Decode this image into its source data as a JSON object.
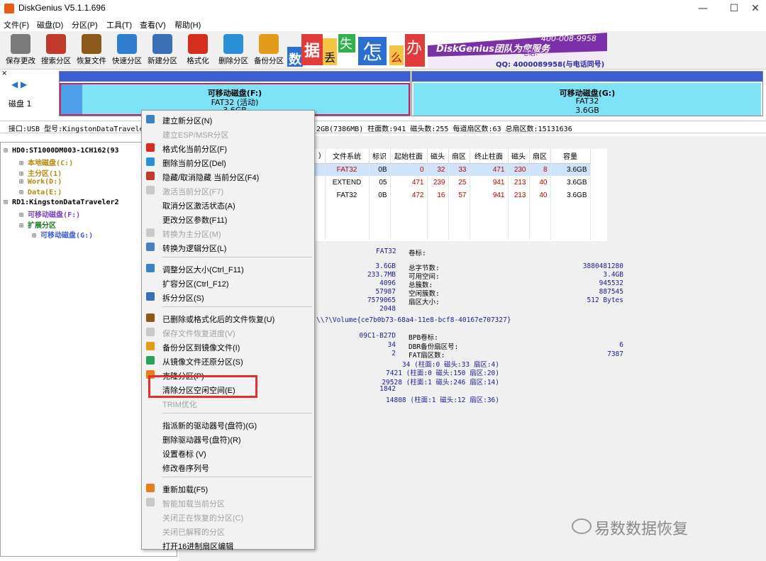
{
  "window": {
    "title": "DiskGenius V5.1.1.696",
    "min": "—",
    "max": "☐",
    "close": "✕"
  },
  "menubar": [
    "文件(F)",
    "磁盘(D)",
    "分区(P)",
    "工具(T)",
    "查看(V)",
    "帮助(H)"
  ],
  "toolbar": [
    {
      "label": "保存更改",
      "icon": "save-icon",
      "color": "#7a7a7a"
    },
    {
      "label": "搜索分区",
      "icon": "magnifier-icon",
      "color": "#c0392b"
    },
    {
      "label": "恢复文件",
      "icon": "recover-box-icon",
      "color": "#8e5a1c"
    },
    {
      "label": "快速分区",
      "icon": "disk-clock-icon",
      "color": "#2e7dd1"
    },
    {
      "label": "新建分区",
      "icon": "new-partition-icon",
      "color": "#3b6fb5"
    },
    {
      "label": "格式化",
      "icon": "format-icon",
      "color": "#d62d20"
    },
    {
      "label": "删除分区",
      "icon": "trash-icon",
      "color": "#2b8fd8"
    },
    {
      "label": "备份分区",
      "icon": "backup-icon",
      "color": "#e39b1b"
    }
  ],
  "banner": {
    "chars": [
      "数",
      "据",
      "丢",
      "失",
      "怎",
      "么",
      "办"
    ],
    "brand": "DiskGenius团队为您服务",
    "phone": "400-008-9958",
    "qq": "QQ: 4000089958(与电话同号)",
    "label": "电话:"
  },
  "diskbar": {
    "nav": "◀ ▶",
    "disk_label": "磁盘 1",
    "part1": {
      "name": "可移动磁盘(F:)",
      "fs": "FAT32 (活动)",
      "size": "3.6GB"
    },
    "part2": {
      "name": "可移动磁盘(G:)",
      "fs": "FAT32",
      "size": "3.6GB"
    }
  },
  "infobar": {
    "left": "接口:USB  型号:KingstonDataTravele",
    "right": "2GB(7386MB)  柱面数:941  磁头数:255  每道扇区数:63  总扇区数:15131636"
  },
  "tree": [
    {
      "text": "HD0:ST1000DM003-1CH162(93",
      "color": "#000"
    },
    {
      "text": "本地磁盘(C:)",
      "color": "#b8860b"
    },
    {
      "text": "主分区(1)",
      "color": "#b8860b"
    },
    {
      "text": "Work(D:)",
      "color": "#b8860b"
    },
    {
      "text": "Data(E:)",
      "color": "#b8860b"
    },
    {
      "text": "RD1:KingstonDataTraveler2",
      "color": "#000"
    },
    {
      "text": "可移动磁盘(F:)",
      "color": "#7b3fbf"
    },
    {
      "text": "扩展分区",
      "color": "#1a7a1a"
    },
    {
      "text": "可移动磁盘(G:)",
      "color": "#3b5bdb"
    }
  ],
  "table": {
    "headers": [
      ")",
      "文件系统",
      "标识",
      "起始柱面",
      "磁头",
      "扇区",
      "终止柱面",
      "磁头",
      "扇区",
      "容量"
    ],
    "rows": [
      [
        "",
        "FAT32",
        "0B",
        "0",
        "32",
        "33",
        "471",
        "230",
        "8",
        "3.6GB"
      ],
      [
        "",
        "EXTEND",
        "05",
        "471",
        "239",
        "25",
        "941",
        "213",
        "40",
        "3.6GB"
      ],
      [
        "",
        "FAT32",
        "0B",
        "472",
        "16",
        "57",
        "941",
        "213",
        "40",
        "3.6GB"
      ]
    ]
  },
  "details": {
    "fs_label": "FAT32",
    "vol_label": "卷标:",
    "left_vals": [
      "3.6GB",
      "233.7MB",
      "4096",
      "57987",
      "7579065",
      "2048"
    ],
    "mid_labels": [
      "总字节数:",
      "可用空间:",
      "总簇数:",
      "空闲簇数:",
      "扇区大小:"
    ],
    "right_vals": [
      "3880481280",
      "3.4GB",
      "945532",
      "887545",
      "512 Bytes"
    ],
    "guid": "\\\\?\\Volume{ce7b0b73-68a4-11e8-bcf8-40167e707327}",
    "left2": [
      "09C1-B27D",
      "34",
      "2",
      "34 (柱面:0 磁头:33 扇区:4)",
      "7421 (柱面:0 磁头:150 扇区:20)",
      "29528 (柱面:1 磁头:246 扇区:14)",
      "1842",
      "14808 (柱面:1 磁头:12 扇区:36)"
    ],
    "mid2": [
      "BPB卷标:",
      "DBR备份扇区号:",
      "FAT扇区数:"
    ],
    "right2": [
      "6",
      "7387"
    ]
  },
  "context_menu": [
    {
      "label": "建立新分区(N)",
      "enabled": true,
      "icon": "new-partition-icon",
      "color": "#3b82c4"
    },
    {
      "label": "建立ESP/MSR分区",
      "enabled": false,
      "icon": "",
      "color": ""
    },
    {
      "label": "格式化当前分区(F)",
      "enabled": true,
      "icon": "format-icon",
      "color": "#d62d20"
    },
    {
      "label": "删除当前分区(Del)",
      "enabled": true,
      "icon": "trash-icon",
      "color": "#2b8fd8"
    },
    {
      "label": "隐藏/取消隐藏 当前分区(F4)",
      "enabled": true,
      "icon": "hide-icon",
      "color": "#c0392b"
    },
    {
      "label": "激活当前分区(F7)",
      "enabled": false,
      "icon": "activate-icon",
      "color": "#c9c9c9"
    },
    {
      "label": "取消分区激活状态(A)",
      "enabled": true,
      "icon": "",
      "color": ""
    },
    {
      "label": "更改分区参数(F11)",
      "enabled": true,
      "icon": "",
      "color": ""
    },
    {
      "label": "转换为主分区(M)",
      "enabled": false,
      "icon": "convert-primary-icon",
      "color": "#c9c9c9"
    },
    {
      "label": "转换为逻辑分区(L)",
      "enabled": true,
      "icon": "convert-logical-icon",
      "color": "#4a7fc0"
    },
    {
      "sep": true
    },
    {
      "label": "调整分区大小(Ctrl_F11)",
      "enabled": true,
      "icon": "resize-icon",
      "color": "#3b82c4"
    },
    {
      "label": "扩容分区(Ctrl_F12)",
      "enabled": true,
      "icon": "",
      "color": ""
    },
    {
      "label": "拆分分区(S)",
      "enabled": true,
      "icon": "split-icon",
      "color": "#3b6fb5"
    },
    {
      "sep": true
    },
    {
      "label": "已删除或格式化后的文件恢复(U)",
      "enabled": true,
      "icon": "recover-icon",
      "color": "#8e5a1c"
    },
    {
      "label": "保存文件恢复进度(V)",
      "enabled": false,
      "icon": "save-progress-icon",
      "color": "#c9c9c9"
    },
    {
      "label": "备份分区到镜像文件(I)",
      "enabled": true,
      "icon": "backup-icon",
      "color": "#e39b1b"
    },
    {
      "label": "从镜像文件还原分区(S)",
      "enabled": true,
      "icon": "restore-icon",
      "color": "#2e9f5a"
    },
    {
      "label": "克隆分区(P)",
      "enabled": true,
      "icon": "clone-icon",
      "color": "#e67e22"
    },
    {
      "label": "清除分区空闲空间(E)",
      "enabled": true,
      "icon": "",
      "color": ""
    },
    {
      "label": "TRIM优化",
      "enabled": false,
      "icon": "",
      "color": ""
    },
    {
      "sep": true
    },
    {
      "label": "指派新的驱动器号(盘符)(G)",
      "enabled": true,
      "icon": "",
      "color": ""
    },
    {
      "label": "删除驱动器号(盘符)(R)",
      "enabled": true,
      "icon": "",
      "color": ""
    },
    {
      "label": "设置卷标 (V)",
      "enabled": true,
      "icon": "",
      "color": ""
    },
    {
      "label": "修改卷序列号",
      "enabled": true,
      "icon": "",
      "color": ""
    },
    {
      "sep": true
    },
    {
      "label": "重新加载(F5)",
      "enabled": true,
      "icon": "reload-icon",
      "color": "#e67e22"
    },
    {
      "label": "智能加载当前分区",
      "enabled": false,
      "icon": "smart-load-icon",
      "color": "#c9c9c9"
    },
    {
      "label": "关闭正在恢复的分区(C)",
      "enabled": false,
      "icon": "",
      "color": ""
    },
    {
      "label": "关闭已解释的分区",
      "enabled": false,
      "icon": "",
      "color": ""
    },
    {
      "label": "打开16进制扇区编辑",
      "enabled": true,
      "icon": "",
      "color": ""
    }
  ],
  "watermark": "易数数据恢复"
}
